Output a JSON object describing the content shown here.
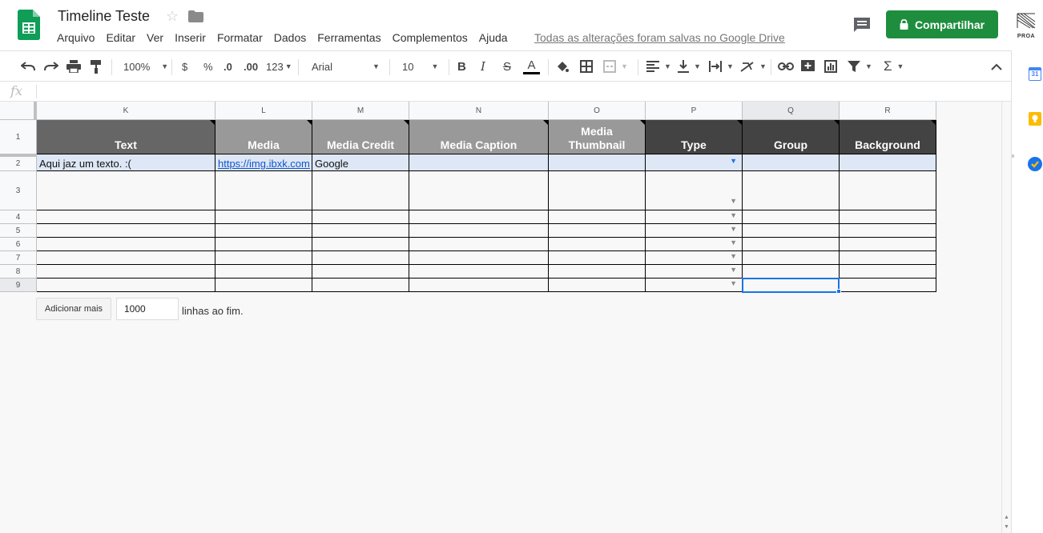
{
  "app": {
    "title": "Timeline Teste",
    "share_label": "Compartilhar",
    "saved_status": "Todas as alterações foram salvas no Google Drive",
    "brand_color": "#1e8e3e",
    "proa_label": "PROA"
  },
  "menu": [
    "Arquivo",
    "Editar",
    "Ver",
    "Inserir",
    "Formatar",
    "Dados",
    "Ferramentas",
    "Complementos",
    "Ajuda"
  ],
  "toolbar": {
    "zoom": "100%",
    "currency": "$",
    "percent": "%",
    "dec_decrease": ".0",
    "dec_increase": ".00",
    "more_formats": "123",
    "font": "Arial",
    "font_size": "10",
    "bold": "B",
    "italic": "I",
    "strike": "S",
    "text_color": "A",
    "sum": "Σ"
  },
  "formula_bar": {
    "fx": "fx"
  },
  "columns": [
    "K",
    "L",
    "M",
    "N",
    "O",
    "P",
    "Q",
    "R"
  ],
  "rows": [
    "1",
    "2",
    "3",
    "4",
    "5",
    "6",
    "7",
    "8",
    "9"
  ],
  "header_row": [
    "Text",
    "Media",
    "Media Credit",
    "Media Caption",
    "Media\nThumbnail",
    "Type",
    "Group",
    "Background"
  ],
  "row2": {
    "text": "Aqui jaz um texto. :(",
    "media": "https://img.ibxk.com",
    "media_credit": "Google"
  },
  "footer": {
    "add_more_label": "Adicionar mais",
    "rows_value": "1000",
    "rows_suffix": "linhas ao fim."
  },
  "side_panel": {
    "calendar_label": "31"
  }
}
